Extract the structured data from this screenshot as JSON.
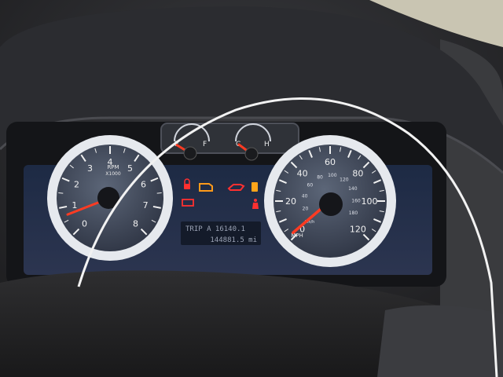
{
  "tachometer": {
    "unit": "RPM",
    "multiplier": "X1000",
    "ticks": [
      "0",
      "1",
      "2",
      "3",
      "4",
      "5",
      "6",
      "7",
      "8"
    ],
    "needle_value": 0.7
  },
  "fuel_gauge": {
    "empty_label": "E",
    "full_label": "F",
    "level_fraction": 0.08
  },
  "temp_gauge": {
    "cold_label": "C",
    "hot_label": "H",
    "level_fraction": 0.12
  },
  "speedometer": {
    "unit": "MPH",
    "outer_ticks": [
      "0",
      "20",
      "40",
      "60",
      "80",
      "100",
      "120"
    ],
    "inner_ticks": [
      "20",
      "40",
      "60",
      "80",
      "100",
      "120",
      "140",
      "160",
      "180"
    ],
    "inner_unit": "km/h",
    "needle_value": 2
  },
  "odometer": {
    "trip_line": "TRIP A 16140.1",
    "total_line": "144881.5 mi"
  },
  "warning_lights": [
    {
      "name": "security-icon",
      "color": "#ff3030"
    },
    {
      "name": "check-engine-icon",
      "color": "#ff9a1a"
    },
    {
      "name": "oil-pressure-icon",
      "color": "#ff3030"
    },
    {
      "name": "fuel-cap-icon",
      "color": "#ffa51a"
    },
    {
      "name": "battery-icon",
      "color": "#ff3030"
    },
    {
      "name": "seatbelt-icon",
      "color": "#ff3030"
    }
  ],
  "colors": {
    "needle": "#ff3b22",
    "dial_ring": "#e6e9ee",
    "lcd": "#9aa2b4"
  }
}
